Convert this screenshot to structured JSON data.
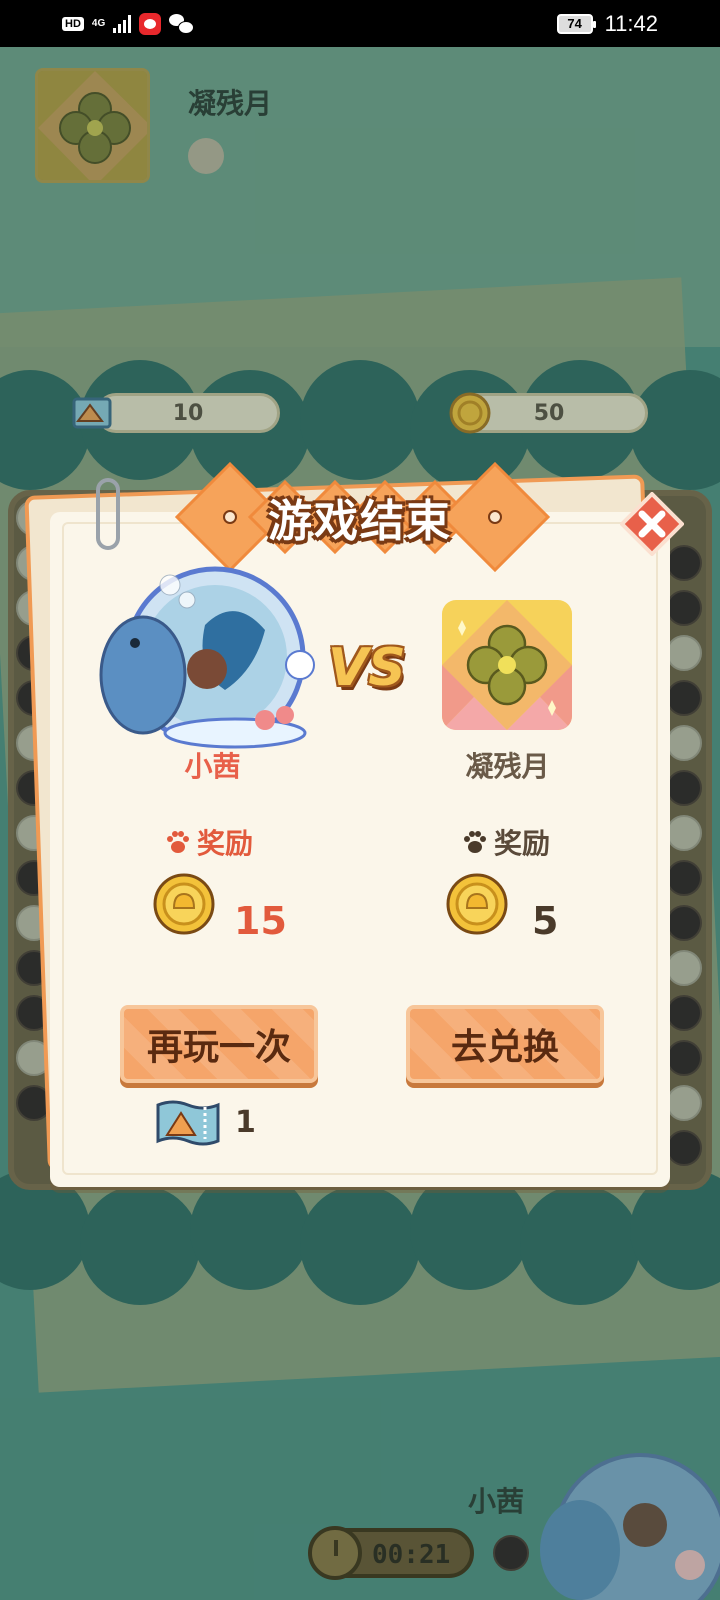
{
  "status_bar": {
    "hd": "HD",
    "network": "4G",
    "battery": "74",
    "time": "11:42"
  },
  "background": {
    "opponent_name": "凝残月",
    "player_name": "小茜",
    "tickets": "10",
    "coins": "50",
    "timer": "00:21"
  },
  "dialog": {
    "title": "游戏结束",
    "vs": "VS",
    "player": {
      "name": "小茜",
      "reward_label": "奖励",
      "reward_value": "15"
    },
    "opponent": {
      "name": "凝残月",
      "reward_label": "奖励",
      "reward_value": "5"
    },
    "buttons": {
      "play_again": "再玩一次",
      "exchange": "去兑换"
    },
    "ticket_count": "1"
  },
  "colors": {
    "accent_orange": "#f5a56a",
    "player_red": "#e25a3c",
    "coin_gold": "#f3c23a"
  }
}
